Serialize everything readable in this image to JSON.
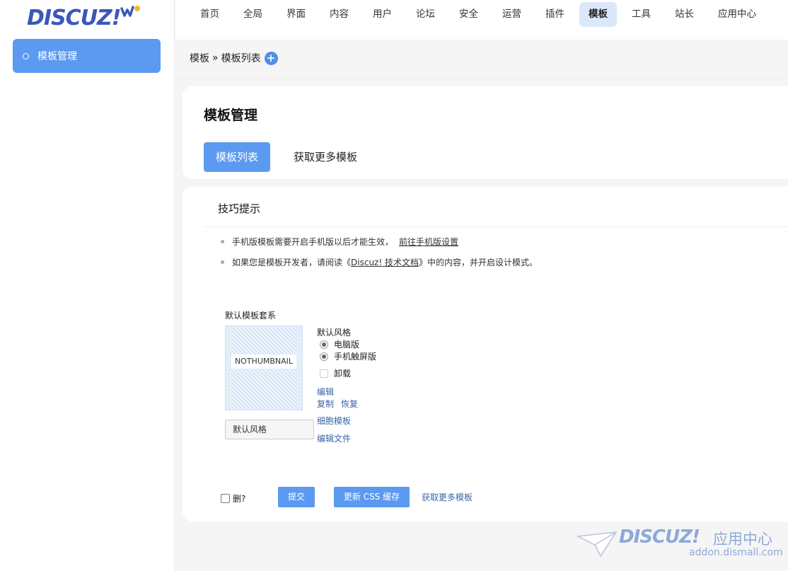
{
  "brand": {
    "logo_text": "DISCUZ!"
  },
  "sidebar": {
    "items": [
      {
        "label": "模板管理"
      }
    ]
  },
  "topnav": {
    "items": [
      {
        "label": "首页"
      },
      {
        "label": "全局"
      },
      {
        "label": "界面"
      },
      {
        "label": "内容"
      },
      {
        "label": "用户"
      },
      {
        "label": "论坛"
      },
      {
        "label": "安全"
      },
      {
        "label": "运营"
      },
      {
        "label": "插件"
      },
      {
        "label": "模板"
      },
      {
        "label": "工具"
      },
      {
        "label": "站长"
      },
      {
        "label": "应用中心"
      }
    ],
    "active": "模板"
  },
  "breadcrumb": {
    "root": "模板",
    "sep": "»",
    "current": "模板列表",
    "add": "+"
  },
  "page": {
    "title": "模板管理",
    "tabs": [
      {
        "label": "模板列表"
      },
      {
        "label": "获取更多模板"
      }
    ]
  },
  "tips": {
    "title": "技巧提示",
    "line1_text": "手机版模板需要开启手机版以后才能生效，",
    "line1_link": "前往手机版设置",
    "line2_pre": "如果您是模板开发者，请阅读《",
    "line2_link": "Discuz! 技术文档",
    "line2_post": "》中的内容，并开启设计模式。"
  },
  "template_set": {
    "title": "默认模板套系",
    "thumb_label": "NOTHUMBNAIL",
    "name_value": "默认风格",
    "style_label": "默认风格",
    "options": [
      {
        "label": "电脑版"
      },
      {
        "label": "手机触屏版"
      }
    ],
    "uninstall_label": "卸载",
    "links": {
      "edit": "编辑",
      "copy": "复制",
      "restore": "恢复",
      "cell": "细胞模板",
      "edit_file": "编辑文件"
    }
  },
  "footer": {
    "delete_label": "删?",
    "submit_label": "提交",
    "css_label": "更新 CSS 缓存",
    "more_label": "获取更多模板"
  },
  "watermark": {
    "brand": "DISCUZ!",
    "cn": "应用中心",
    "url": "addon.dismall.com"
  },
  "colors": {
    "accent": "#5b9af0",
    "active_nav": "#dbe8fb",
    "link": "#3a66a8",
    "logo": "#3a58b8"
  }
}
